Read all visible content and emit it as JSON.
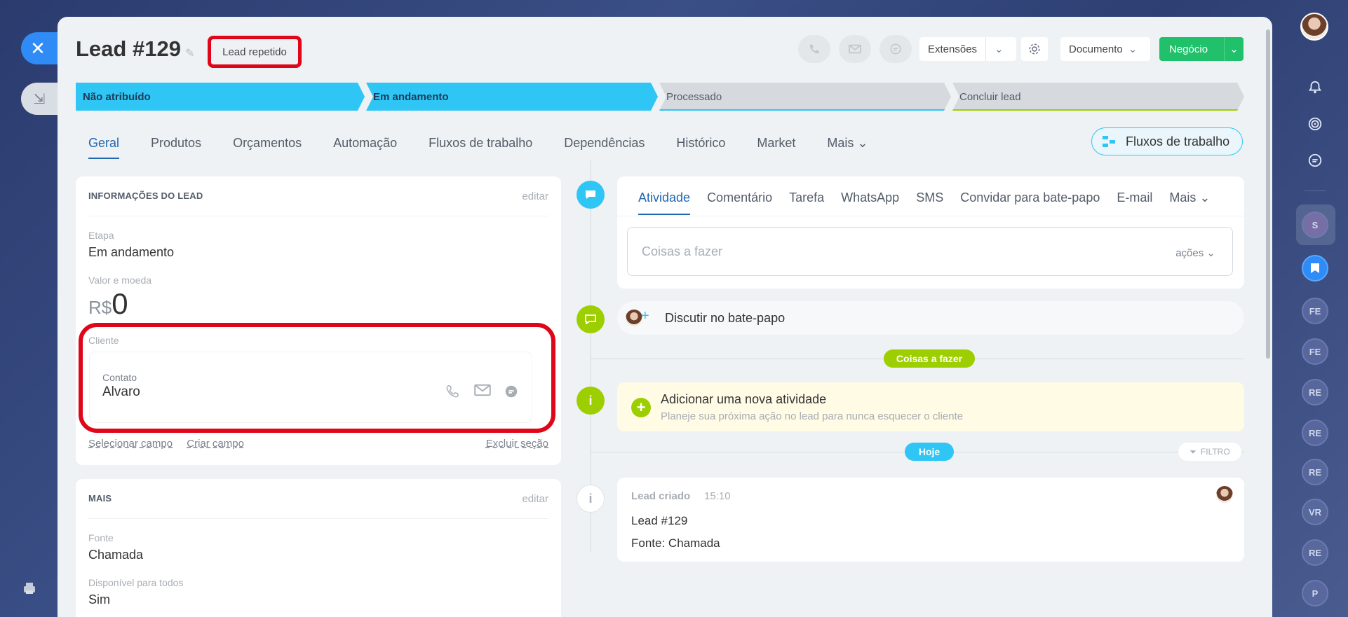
{
  "window": {
    "close_label": "✕",
    "minimize_label": "⇲"
  },
  "lead": {
    "title": "Lead #129",
    "repeat_tag": "Lead repetido"
  },
  "header_actions": {
    "extensoes": "Extensões",
    "documento": "Documento",
    "negocio": "Negócio"
  },
  "stages": [
    "Não atribuído",
    "Em andamento",
    "Processado",
    "Concluir lead"
  ],
  "tabs": [
    "Geral",
    "Produtos",
    "Orçamentos",
    "Automação",
    "Fluxos de trabalho",
    "Dependências",
    "Histórico",
    "Market",
    "Mais"
  ],
  "workflows_button": "Fluxos de trabalho",
  "info_card": {
    "heading": "INFORMAÇÕES DO LEAD",
    "edit": "editar",
    "etapa_label": "Etapa",
    "etapa_value": "Em andamento",
    "valor_label": "Valor e moeda",
    "currency": "R$",
    "amount": "0",
    "cliente_label": "Cliente",
    "contato_label": "Contato",
    "contato_name": "Alvaro",
    "link_select": "Selecionar campo",
    "link_create": "Criar campo",
    "link_delete": "Excluir seção"
  },
  "more_card": {
    "heading": "MAIS",
    "edit": "editar",
    "fonte_label": "Fonte",
    "fonte_value": "Chamada",
    "disp_label": "Disponível para todos",
    "disp_value": "Sim"
  },
  "activity": {
    "tabs": [
      "Atividade",
      "Comentário",
      "Tarefa",
      "WhatsApp",
      "SMS",
      "Convidar para bate-papo",
      "E-mail",
      "Mais"
    ],
    "todo_placeholder": "Coisas a fazer",
    "todo_actions": "ações",
    "chat_label": "Discutir no bate-papo",
    "todo_pill": "Coisas a fazer",
    "add_title": "Adicionar uma nova atividade",
    "add_sub": "Planeje sua próxima ação no lead para nunca esquecer o cliente",
    "today_pill": "Hoje",
    "filter": "FILTRO",
    "entry_title": "Lead criado",
    "entry_time": "15:10",
    "entry_line1": "Lead #129",
    "entry_line2": "Fonte: Chamada"
  },
  "right_rail": {
    "avatars": [
      "S",
      "FE",
      "FE",
      "RE",
      "RE",
      "RE",
      "VR",
      "RE",
      "P"
    ]
  },
  "colors": {
    "accent_blue": "#2fc6f6",
    "green": "#21c16b",
    "highlight_red": "#e0061a",
    "lime": "#9dcf00"
  }
}
